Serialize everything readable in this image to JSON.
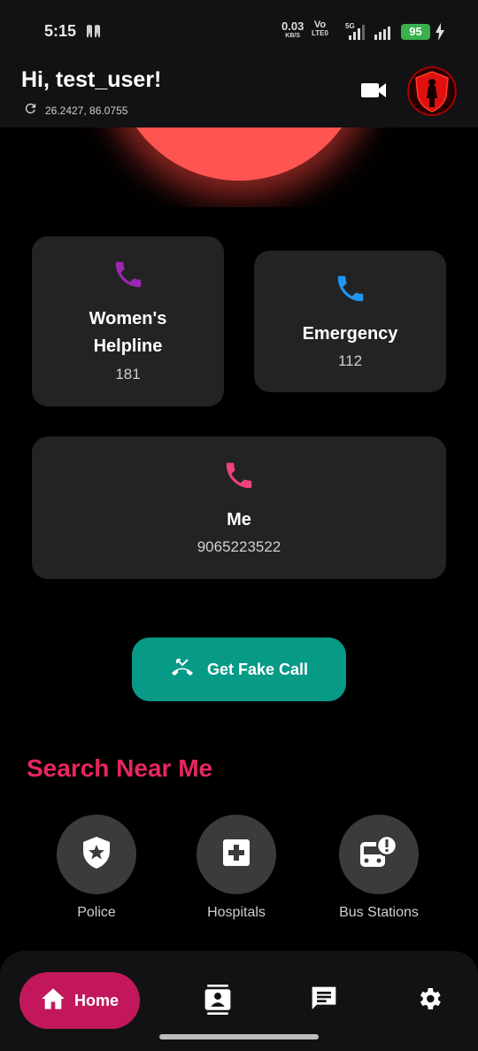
{
  "status_bar": {
    "time": "5:15",
    "net_speed_value": "0.03",
    "net_speed_unit": "KB/S",
    "volte_top": "Vo",
    "volte_bottom": "LTE0",
    "network_type": "5G",
    "battery": "95"
  },
  "header": {
    "greeting": "Hi, test_user!",
    "coordinates": "26.2427, 86.0755",
    "icons": [
      "refresh-icon",
      "video-camera-icon",
      "avatar"
    ]
  },
  "helplines": [
    {
      "title_line1": "Women's",
      "title_line2": "Helpline",
      "number": "181",
      "icon_color": "#9c27b0"
    },
    {
      "title": "Emergency",
      "number": "112",
      "icon_color": "#2196f3"
    },
    {
      "title": "Me",
      "number": "9065223522",
      "icon_color": "#f0417a"
    }
  ],
  "fake_call": {
    "label": "Get Fake Call",
    "color": "#079a87"
  },
  "search_near_me": {
    "title": "Search Near Me",
    "items": [
      {
        "label": "Police",
        "icon": "police-shield-icon"
      },
      {
        "label": "Hospitals",
        "icon": "hospital-plus-icon"
      },
      {
        "label": "Bus Stations",
        "icon": "bus-alert-icon"
      }
    ]
  },
  "bottom_nav": {
    "home_label": "Home",
    "items": [
      "home-icon",
      "contacts-icon",
      "chat-icon",
      "settings-icon"
    ],
    "active_color": "#c2185b"
  },
  "colors": {
    "accent_pink": "#e8265e",
    "sos_red": "#ff5552",
    "card_bg": "#232323"
  }
}
